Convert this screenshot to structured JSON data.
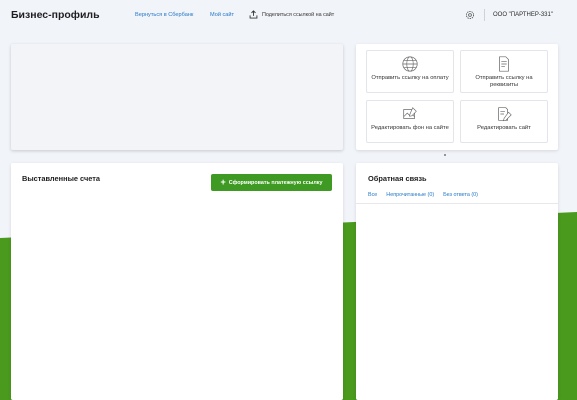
{
  "header": {
    "logo": "Бизнес-профиль",
    "back_link": "Вернуться в Сбербанк",
    "my_site_link": "Мой сайт",
    "share_label": "Поделиться ссылкой на сайт",
    "company": "ООО \"ПАРТНЕР-331\""
  },
  "actions": [
    {
      "label": "Отправить ссылку на оплату",
      "icon": "globe-icon"
    },
    {
      "label": "Отправить ссылку на реквизиты",
      "icon": "document-icon"
    },
    {
      "label": "Редактировать фон на сайте",
      "icon": "image-edit-icon"
    },
    {
      "label": "Редактировать сайт",
      "icon": "page-edit-icon"
    }
  ],
  "invoices": {
    "title": "Выставленные счета",
    "create_button": "Сформировать платежную ссылку"
  },
  "feedback": {
    "title": "Обратная связь",
    "tabs": [
      "Все",
      "Непрочитанные (0)",
      "Без ответа (0)"
    ]
  },
  "colors": {
    "accent_green": "#3f9a24",
    "background_green": "#4a9a1e",
    "link_blue": "#2478c8"
  }
}
